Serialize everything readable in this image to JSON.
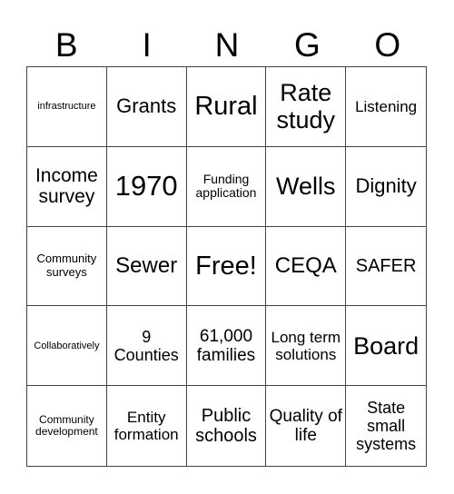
{
  "header": {
    "letters": [
      "B",
      "I",
      "N",
      "G",
      "O"
    ]
  },
  "cells": [
    {
      "text": "infrastructure",
      "size": 11
    },
    {
      "text": "Grants",
      "size": 22
    },
    {
      "text": "Rural",
      "size": 29
    },
    {
      "text": "Rate study",
      "size": 27
    },
    {
      "text": "Listening",
      "size": 17
    },
    {
      "text": "Income survey",
      "size": 21
    },
    {
      "text": "1970",
      "size": 31
    },
    {
      "text": "Funding application",
      "size": 14
    },
    {
      "text": "Wells",
      "size": 27
    },
    {
      "text": "Dignity",
      "size": 22
    },
    {
      "text": "Community surveys",
      "size": 13
    },
    {
      "text": "Sewer",
      "size": 24
    },
    {
      "text": "Free!",
      "size": 29
    },
    {
      "text": "CEQA",
      "size": 24
    },
    {
      "text": "SAFER",
      "size": 20
    },
    {
      "text": "Collaboratively",
      "size": 11
    },
    {
      "text": "9 Counties",
      "size": 18
    },
    {
      "text": "61,000 families",
      "size": 19
    },
    {
      "text": "Long term solutions",
      "size": 17
    },
    {
      "text": "Board",
      "size": 27
    },
    {
      "text": "Community development",
      "size": 12
    },
    {
      "text": "Entity formation",
      "size": 17
    },
    {
      "text": "Public schools",
      "size": 20
    },
    {
      "text": "Quality of life",
      "size": 19
    },
    {
      "text": "State small systems",
      "size": 18
    }
  ]
}
